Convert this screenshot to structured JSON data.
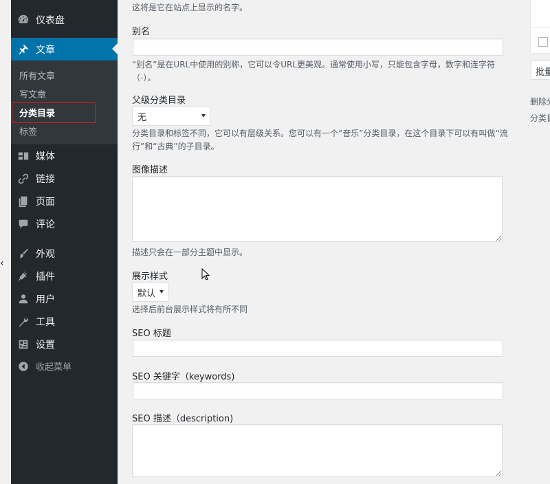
{
  "sidebar": {
    "items": [
      {
        "label": "仪表盘",
        "icon": "dashboard-icon"
      },
      {
        "label": "文章",
        "icon": "pushpin-icon"
      },
      {
        "label": "媒体",
        "icon": "media-icon"
      },
      {
        "label": "链接",
        "icon": "link-icon"
      },
      {
        "label": "页面",
        "icon": "page-icon"
      },
      {
        "label": "评论",
        "icon": "comment-icon"
      },
      {
        "label": "外观",
        "icon": "paintbrush-icon"
      },
      {
        "label": "插件",
        "icon": "plugin-icon"
      },
      {
        "label": "用户",
        "icon": "user-icon"
      },
      {
        "label": "工具",
        "icon": "wrench-icon"
      },
      {
        "label": "设置",
        "icon": "settings-icon"
      }
    ],
    "submenu": [
      "所有文章",
      "写文章",
      "分类目录",
      "标签"
    ],
    "collapse_label": "收起菜单",
    "collapse_icon": "collapse-icon",
    "accent_color": "#0073aa",
    "highlight_color": "#d01f1f"
  },
  "form": {
    "name_help": "这将是它在站点上显示的名字。",
    "slug_label": "别名",
    "slug_value": "",
    "slug_help_1": "“别名”是在URL中使用的别称，它可以令URL更美观。通常使用小写，只能包含字母，数字和连字符",
    "slug_help_2": "（-）。",
    "parent_label": "父级分类目录",
    "parent_value": "无",
    "parent_help_1": "分类目录和标签不同，它可以有层级关系。您可以有一个“音乐”分类目录，在这个目录下可以有叫做“流",
    "parent_help_2": "行”和“古典”的子目录。",
    "desc_label": "图像描述",
    "desc_help": "描述只会在一部分主题中显示。",
    "style_label": "展示样式",
    "style_value": "默认",
    "style_help": "选择后前台展示样式将有所不同",
    "seo_title_label": "SEO 标题",
    "seo_keywords_label": "SEO 关键字（keywords)",
    "seo_desc_label": "SEO 描述（description)"
  },
  "right_panel": {
    "bulk_label": "批量",
    "note_1": "删除分",
    "note_2": "分类目"
  }
}
